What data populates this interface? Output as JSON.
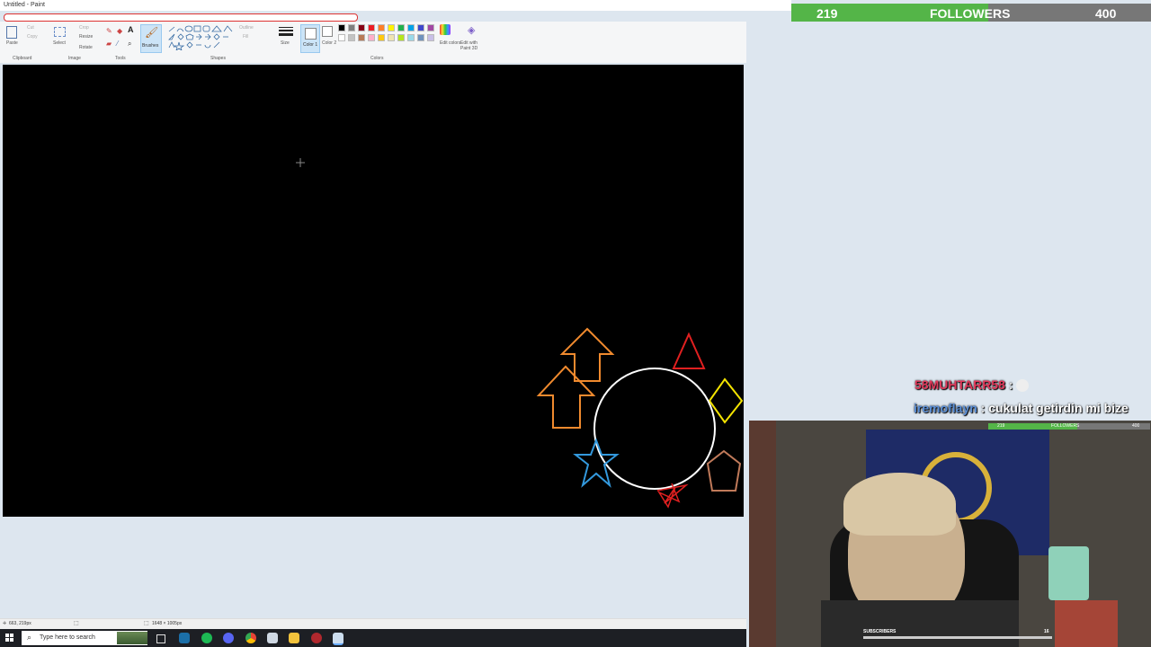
{
  "window": {
    "title": "Untitled - Paint"
  },
  "ribbon": {
    "groups": {
      "clipboard": "Clipboard",
      "image": "Image",
      "tools": "Tools",
      "shapes": "Shapes",
      "colors": "Colors"
    },
    "paste": "Paste",
    "cut": "Cut",
    "copy": "Copy",
    "select": "Select",
    "crop": "Crop",
    "resize": "Resize",
    "rotate": "Rotate",
    "brushes": "Brushes",
    "outline": "Outline",
    "fill": "Fill",
    "size": "Size",
    "color1": "Color 1",
    "color2": "Color 2",
    "edit_colors": "Edit colors",
    "edit_paint3d": "Edit with Paint 3D"
  },
  "palette": [
    "#000000",
    "#7f7f7f",
    "#880015",
    "#ed1c24",
    "#ff7f27",
    "#fff200",
    "#22b14c",
    "#00a2e8",
    "#3f48cc",
    "#a349a4",
    "#ffffff",
    "#c3c3c3",
    "#b97a57",
    "#ffaec9",
    "#ffc90e",
    "#efe4b0",
    "#b5e61d",
    "#99d9ea",
    "#7092be",
    "#c8bfe7"
  ],
  "status": {
    "cursor": "663, 219px",
    "size": "1648 × 1005px"
  },
  "taskbar": {
    "search_placeholder": "Type here to search"
  },
  "followers": {
    "current": "219",
    "label": "FOLLOWERS",
    "goal": "400",
    "progress": 0.5475
  },
  "chat": [
    {
      "user": "58MUHTARR58",
      "sep": ":",
      "message": "",
      "user_color": "#e23a5c"
    },
    {
      "user": "iremoflayn",
      "sep": ":",
      "message": "cukulat getirdin mi bize",
      "user_color": "#5b8fd6"
    }
  ],
  "webcam": {
    "overlay_followers": "FOLLOWERS",
    "overlay_current": "219",
    "overlay_goal": "400",
    "subscribers_label": "SUBSCRIBERS",
    "subscribers_goal": "16"
  },
  "colors": {
    "follower_fill": "#54b548",
    "canvas": "#000000"
  }
}
